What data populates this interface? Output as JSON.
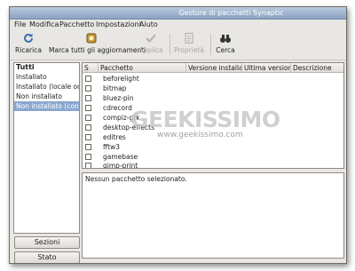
{
  "window": {
    "title": "Gestore di pacchetti Synaptic"
  },
  "menu": {
    "items": [
      "File",
      "Modifica",
      "Pacchetto",
      "Impostazioni",
      "Aiuto"
    ]
  },
  "toolbar": {
    "reload": "Ricarica",
    "mark_all": "Marca tutti gli aggiornamenti",
    "apply": "Applica",
    "properties": "Proprietà",
    "search": "Cerca"
  },
  "sidebar": {
    "header": "Tutti",
    "items": [
      "Installato",
      "Installato (locale od ob",
      "Non installato",
      "Non installato (configu"
    ],
    "selected_index": 3,
    "sections_button": "Sezioni",
    "status_button": "Stato"
  },
  "package_list": {
    "columns": [
      "S",
      "Pacchetto",
      "Versione installata",
      "Ultima versione",
      "Descrizione"
    ],
    "packages": [
      "beforelight",
      "bitmap",
      "bluez-pin",
      "cdrecord",
      "compiz-gtk",
      "desktop-effects",
      "editres",
      "fftw3",
      "gamebase",
      "gimp-print"
    ]
  },
  "description": {
    "text": "Nessun pacchetto selezionato."
  },
  "watermark": {
    "brand": "GEEKISSIMO",
    "url": "www.geekissimo.com"
  }
}
